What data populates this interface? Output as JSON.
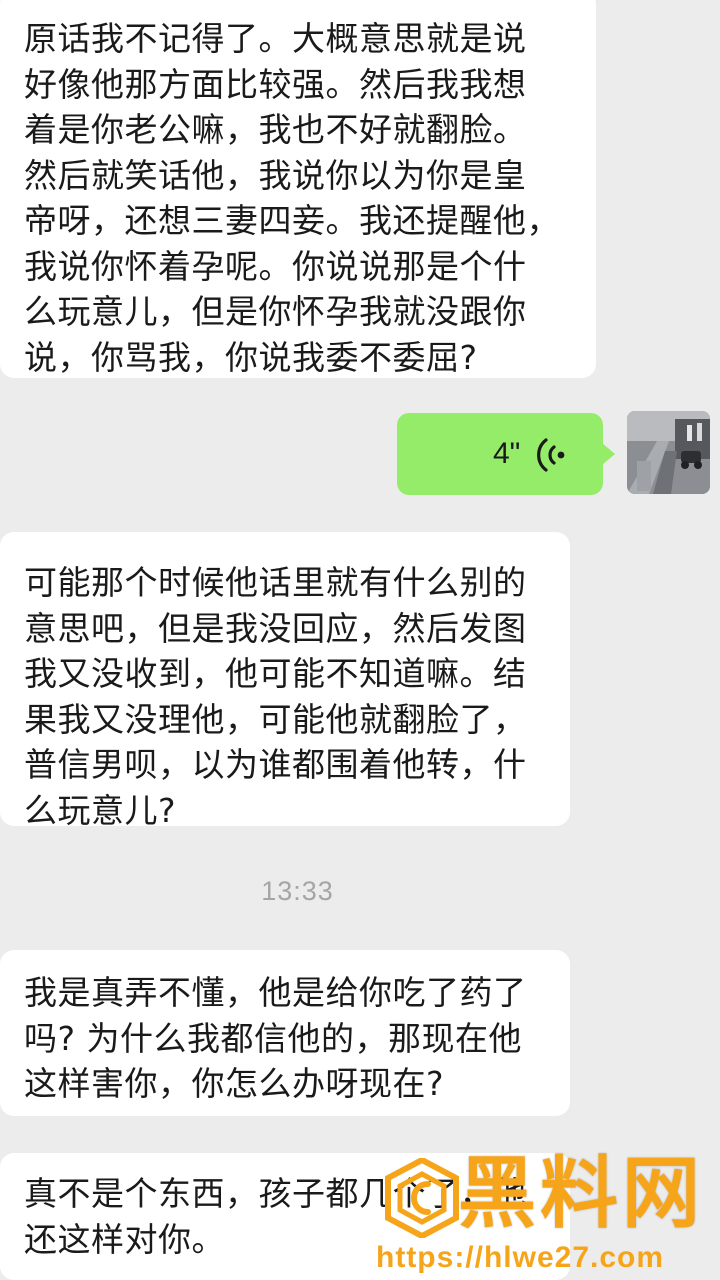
{
  "messages": [
    {
      "direction": "incoming",
      "text": "原话我不记得了。大概意思就是说\n好像他那方面比较强。然后我我想\n着是你老公嘛，我也不好就翻脸。\n然后就笑话他，我说你以为你是皇\n帝呀，还想三妻四妾。我还提醒他，\n我说你怀着孕呢。你说说那是个什\n么玩意儿，但是你怀孕我就没跟你\n说，你骂我，你说我委不委屈?"
    },
    {
      "direction": "outgoing",
      "type": "voice",
      "duration": "4\"",
      "icon": "voice-wave-icon"
    },
    {
      "direction": "incoming",
      "text": "可能那个时候他话里就有什么别的\n意思吧，但是我没回应，然后发图\n我又没收到，他可能不知道嘛。结\n果我又没理他，可能他就翻脸了，\n普信男呗，以为谁都围着他转，什\n么玩意儿?"
    },
    {
      "direction": "incoming",
      "text": "我是真弄不懂，他是给你吃了药了\n吗? 为什么我都信他的，那现在他\n这样害你，你怎么办呀现在?"
    },
    {
      "direction": "incoming",
      "text": "真不是个东西，孩子都几个了，他\n还这样对你。"
    }
  ],
  "timestamp": "13:33",
  "watermark": {
    "title": "黑料网",
    "url": "https://hlwe27.com"
  },
  "colors": {
    "background": "#ececec",
    "incoming_bubble": "#ffffff",
    "outgoing_bubble": "#95ec69",
    "timestamp": "#a5a5a5",
    "watermark": "#f6a51b"
  }
}
